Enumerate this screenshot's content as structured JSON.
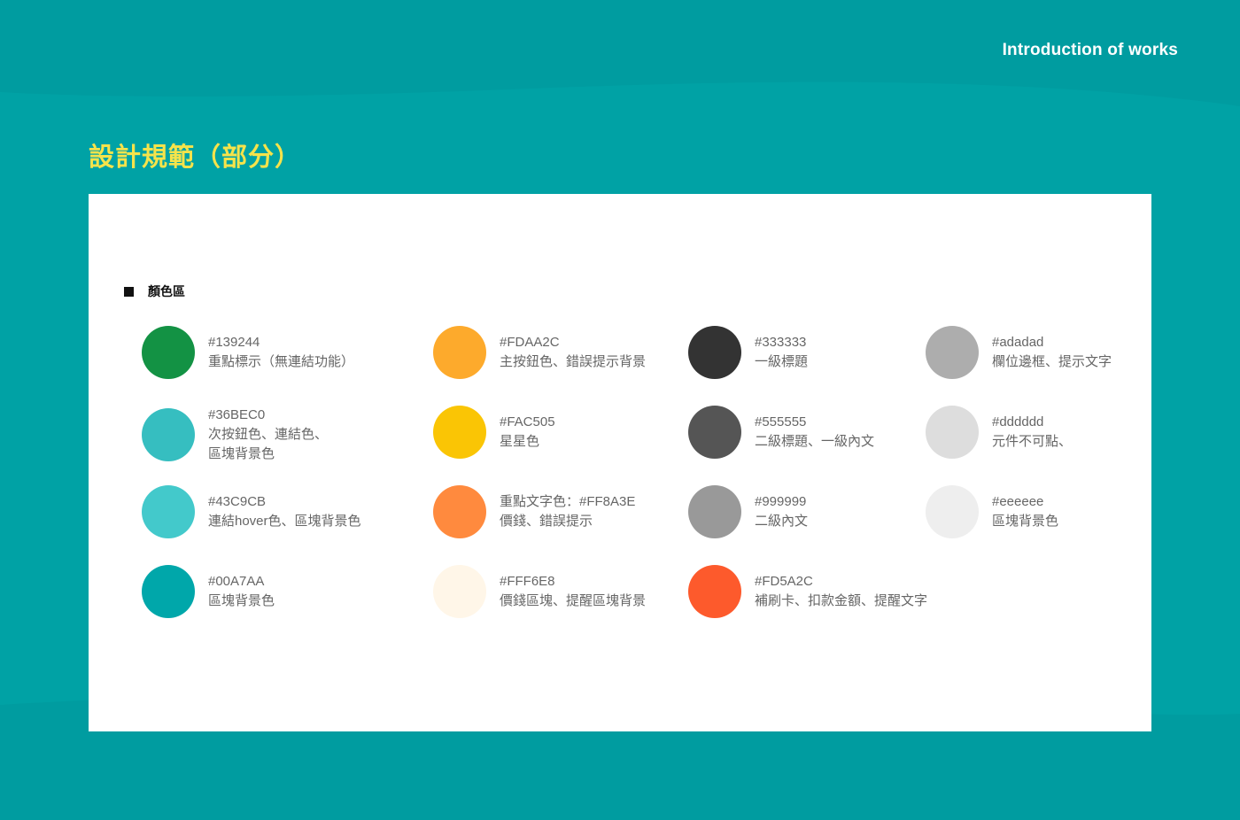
{
  "header": {
    "intro_text": "Introduction of works"
  },
  "page": {
    "title": "設計規範（部分）",
    "background_color": "#00A2A5",
    "title_color": "#F5E34B"
  },
  "panel": {
    "section_title": "顏色區",
    "columns": [
      [
        {
          "color": "#139244",
          "lines": [
            "#139244",
            "重點標示（無連結功能）"
          ]
        },
        {
          "color": "#36BEC0",
          "lines": [
            "#36BEC0",
            "次按鈕色、連結色、",
            "區塊背景色"
          ]
        },
        {
          "color": "#43C9CB",
          "lines": [
            "#43C9CB",
            "連結hover色、區塊背景色"
          ]
        },
        {
          "color": "#00A7AA",
          "lines": [
            "#00A7AA",
            "區塊背景色"
          ]
        }
      ],
      [
        {
          "color": "#FDAA2C",
          "lines": [
            "#FDAA2C",
            "主按鈕色、錯誤提示背景"
          ]
        },
        {
          "color": "#FAC505",
          "lines": [
            "#FAC505",
            "星星色"
          ]
        },
        {
          "color": "#FF8A3E",
          "lines": [
            "重點文字色：#FF8A3E",
            "價錢、錯誤提示"
          ]
        },
        {
          "color": "#FFF6E8",
          "lines": [
            "#FFF6E8",
            "價錢區塊、提醒區塊背景"
          ]
        }
      ],
      [
        {
          "color": "#333333",
          "lines": [
            "#333333",
            "一級標題"
          ]
        },
        {
          "color": "#555555",
          "lines": [
            "#555555",
            "二級標題、一級內文"
          ]
        },
        {
          "color": "#999999",
          "lines": [
            "#999999",
            "二級內文"
          ]
        },
        {
          "color": "#FD5A2C",
          "lines": [
            "#FD5A2C",
            "補刷卡、扣款金額、提醒文字"
          ]
        }
      ],
      [
        {
          "color": "#adadad",
          "lines": [
            "#adadad",
            "欄位邊框、提示文字"
          ]
        },
        {
          "color": "#dddddd",
          "lines": [
            "#dddddd",
            "元件不可點、"
          ]
        },
        {
          "color": "#eeeeee",
          "lines": [
            "#eeeeee",
            "區塊背景色"
          ]
        }
      ]
    ]
  }
}
